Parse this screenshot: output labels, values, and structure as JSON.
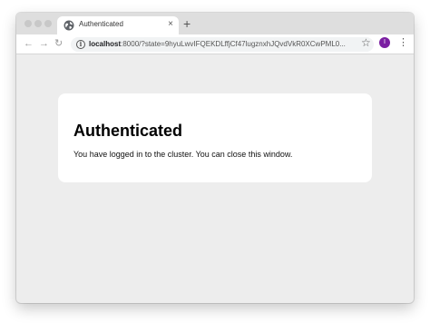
{
  "browser": {
    "tab": {
      "favicon": "globe-icon",
      "title": "Authenticated",
      "close_icon": "×"
    },
    "new_tab_icon": "+",
    "toolbar": {
      "back_icon": "←",
      "forward_icon": "→",
      "reload_icon": "↻",
      "info_icon": "i",
      "url_host": "localhost",
      "url_rest": ":8000/?state=9hyuLwvIFQEKDLffjCf47lugznxhJQvdVkR0XCwPML0...",
      "bookmark_icon": "☆",
      "profile_initial": "I",
      "menu_icon": "⋮"
    },
    "colors": {
      "profile_avatar": "#7b1fa2",
      "page_background": "#ededed"
    }
  },
  "page": {
    "heading": "Authenticated",
    "message": "You have logged in to the cluster. You can close this window."
  }
}
